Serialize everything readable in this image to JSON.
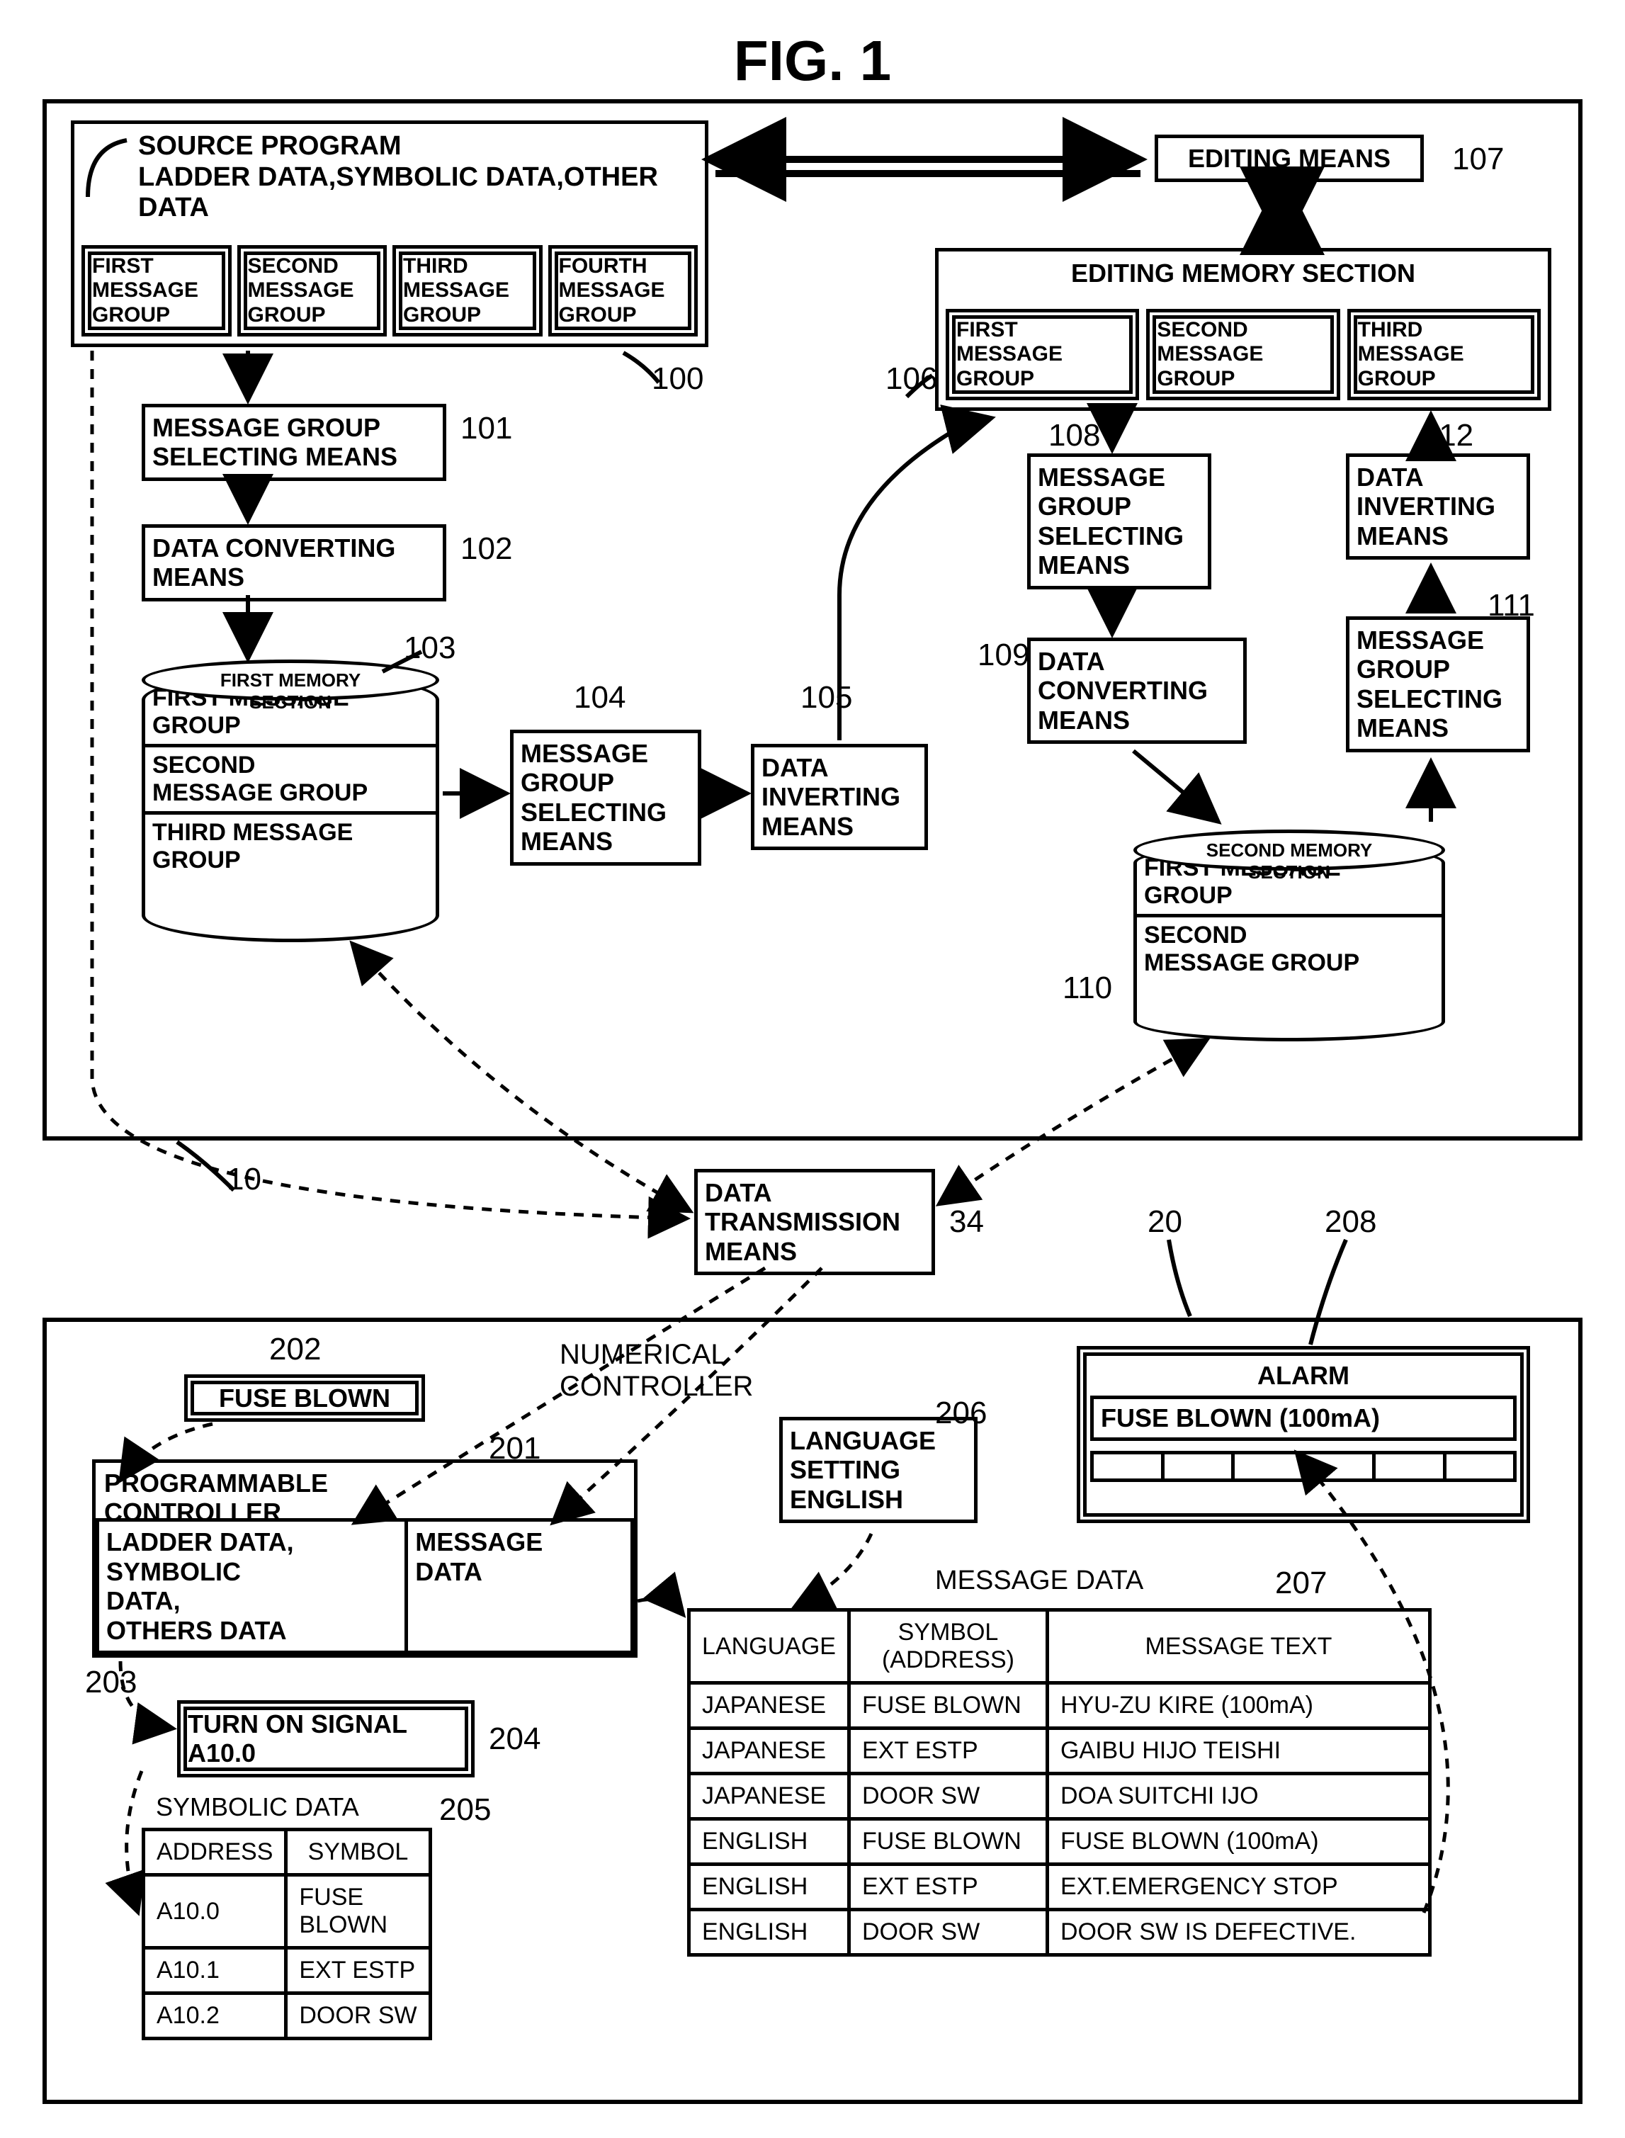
{
  "figure_title": "FIG. 1",
  "top": {
    "source_program_hdr": "SOURCE PROGRAM\nLADDER DATA,SYMBOLIC DATA,OTHER DATA",
    "msg_groups": [
      "FIRST\nMESSAGE\nGROUP",
      "SECOND\nMESSAGE\nGROUP",
      "THIRD\nMESSAGE\nGROUP",
      "FOURTH\nMESSAGE\nGROUP"
    ],
    "b101": "MESSAGE GROUP\nSELECTING MEANS",
    "b102": "DATA CONVERTING\nMEANS",
    "db103_title": "FIRST MEMORY\nSECTION",
    "db103_rows": [
      "FIRST MESSAGE\nGROUP",
      "SECOND\nMESSAGE GROUP",
      "THIRD MESSAGE\nGROUP"
    ],
    "b104": "MESSAGE\nGROUP\nSELECTING\nMEANS",
    "b105": "DATA\nINVERTING\nMEANS",
    "editing_means": "EDITING MEANS",
    "editing_mem_hdr": "EDITING MEMORY SECTION",
    "editing_mem_groups": [
      "FIRST\nMESSAGE\nGROUP",
      "SECOND\nMESSAGE\nGROUP",
      "THIRD\nMESSAGE\nGROUP"
    ],
    "b108": "MESSAGE\nGROUP\nSELECTING\nMEANS",
    "b109": "DATA\nCONVERTING\nMEANS",
    "db110_title": "SECOND MEMORY\nSECTION",
    "db110_rows": [
      "FIRST MESSAGE\nGROUP",
      "SECOND\nMESSAGE GROUP"
    ],
    "b111": "MESSAGE\nGROUP\nSELECTING\nMEANS",
    "b112": "DATA\nINVERTING\nMEANS"
  },
  "mid": {
    "b34": "DATA\nTRANSMISSION\nMEANS"
  },
  "bot": {
    "numctrl": "NUMERICAL\nCONTROLLER",
    "b202": "FUSE BLOWN",
    "b201_hdr": "PROGRAMMABLE\nCONTROLLER",
    "b201_left": "LADDER DATA,\nSYMBOLIC\nDATA,\nOTHERS DATA",
    "b201_right": "MESSAGE\nDATA",
    "b204": "TURN ON SIGNAL\nA10.0",
    "symbolic_hdr": "SYMBOLIC DATA",
    "sym_table": {
      "headers": [
        "ADDRESS",
        "SYMBOL"
      ],
      "rows": [
        [
          "A10.0",
          "FUSE\nBLOWN"
        ],
        [
          "A10.1",
          "EXT ESTP"
        ],
        [
          "A10.2",
          "DOOR SW"
        ]
      ]
    },
    "b206": "LANGUAGE\nSETTING\nENGLISH",
    "alarm_hdr": "ALARM",
    "alarm_text": "FUSE BLOWN (100mA)",
    "msgdata_hdr": "MESSAGE DATA",
    "msg_table": {
      "headers": [
        "LANGUAGE",
        "SYMBOL\n(ADDRESS)",
        "MESSAGE TEXT"
      ],
      "rows": [
        [
          "JAPANESE",
          "FUSE BLOWN",
          "HYU-ZU KIRE (100mA)"
        ],
        [
          "JAPANESE",
          "EXT ESTP",
          "GAIBU HIJO TEISHI"
        ],
        [
          "JAPANESE",
          "DOOR SW",
          "DOA SUITCHI IJO"
        ],
        [
          "ENGLISH",
          "FUSE BLOWN",
          "FUSE BLOWN (100mA)"
        ],
        [
          "ENGLISH",
          "EXT ESTP",
          "EXT.EMERGENCY STOP"
        ],
        [
          "ENGLISH",
          "DOOR SW",
          "DOOR SW IS DEFECTIVE."
        ]
      ]
    }
  },
  "refs": {
    "r100": "100",
    "r101": "101",
    "r102": "102",
    "r103": "103",
    "r104": "104",
    "r105": "105",
    "r106": "106",
    "r107": "107",
    "r108": "108",
    "r109": "109",
    "r110": "110",
    "r111": "111",
    "r112": "112",
    "r10": "10",
    "r34": "34",
    "r20": "20",
    "r201": "201",
    "r202": "202",
    "r203": "203",
    "r204": "204",
    "r205": "205",
    "r206": "206",
    "r207": "207",
    "r208": "208"
  }
}
